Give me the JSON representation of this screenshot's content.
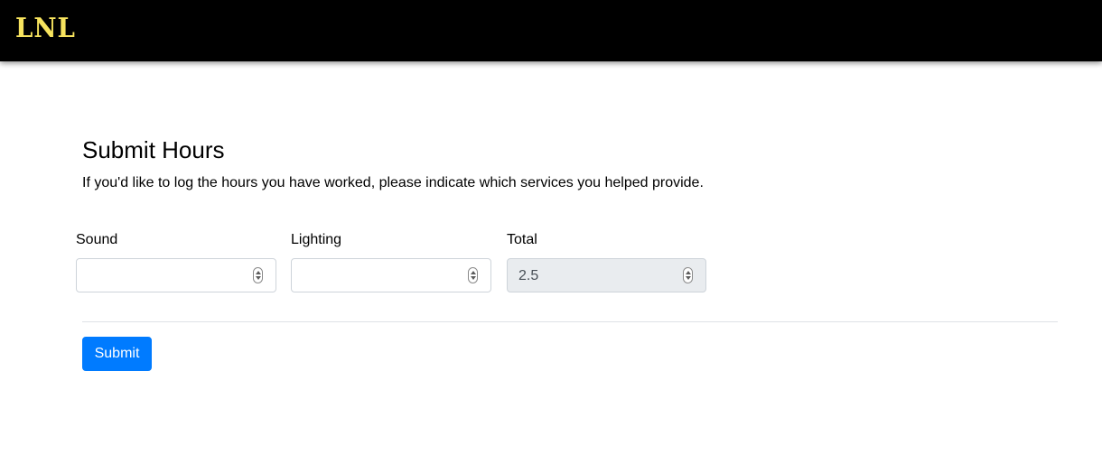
{
  "header": {
    "logo_text": "LNL",
    "background": "#000000",
    "logo_color": "#f7e35e"
  },
  "form": {
    "title": "Submit Hours",
    "description": "If you'd like to log the hours you have worked, please indicate which services you helped provide.",
    "fields": [
      {
        "label": "Sound",
        "value": "",
        "disabled": false
      },
      {
        "label": "Lighting",
        "value": "",
        "disabled": false
      },
      {
        "label": "Total",
        "value": "2.5",
        "disabled": true
      }
    ],
    "submit_label": "Submit",
    "accent_color": "#007bff"
  }
}
